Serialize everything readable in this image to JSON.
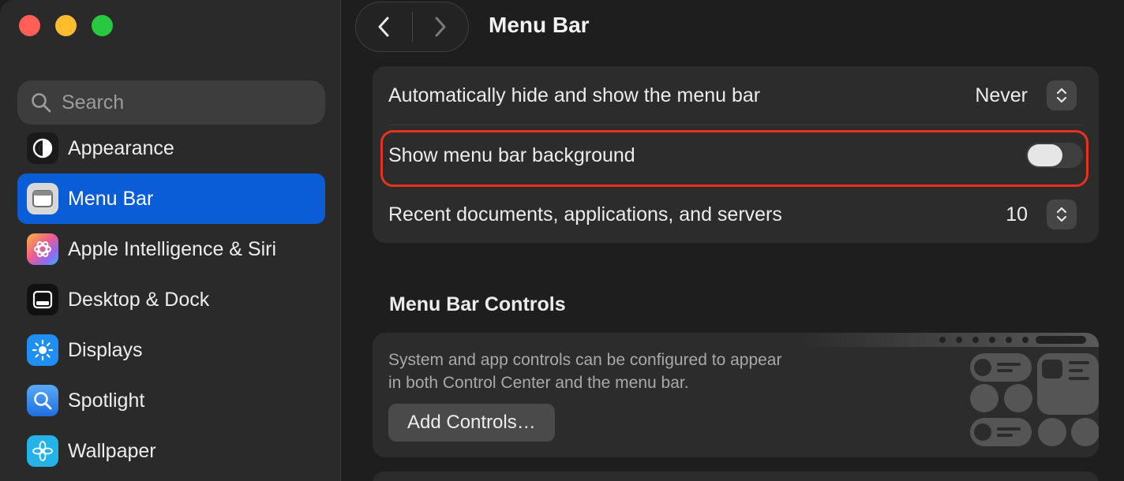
{
  "window": {
    "title": "Menu Bar",
    "colors": {
      "accent": "#0a5cd7",
      "highlight": "#e8321f"
    }
  },
  "sidebar": {
    "search": {
      "placeholder": "Search"
    },
    "items": [
      {
        "label": "Appearance",
        "icon": "appearance-icon",
        "active": false
      },
      {
        "label": "Menu Bar",
        "icon": "menu-bar-icon",
        "active": true
      },
      {
        "label": "Apple Intelligence & Siri",
        "icon": "siri-icon",
        "active": false
      },
      {
        "label": "Desktop & Dock",
        "icon": "dock-icon",
        "active": false
      },
      {
        "label": "Displays",
        "icon": "displays-icon",
        "active": false
      },
      {
        "label": "Spotlight",
        "icon": "spotlight-icon",
        "active": false
      },
      {
        "label": "Wallpaper",
        "icon": "wallpaper-icon",
        "active": false
      }
    ]
  },
  "settings": {
    "auto_hide": {
      "label": "Automatically hide and show the menu bar",
      "value": "Never"
    },
    "show_background": {
      "label": "Show menu bar background",
      "checked": false
    },
    "recent_items": {
      "label": "Recent documents, applications, and servers",
      "value": "10"
    }
  },
  "controls": {
    "title": "Menu Bar Controls",
    "description": "System and app controls can be configured to appear in both Control Center and the menu bar.",
    "add_button": "Add Controls…"
  }
}
